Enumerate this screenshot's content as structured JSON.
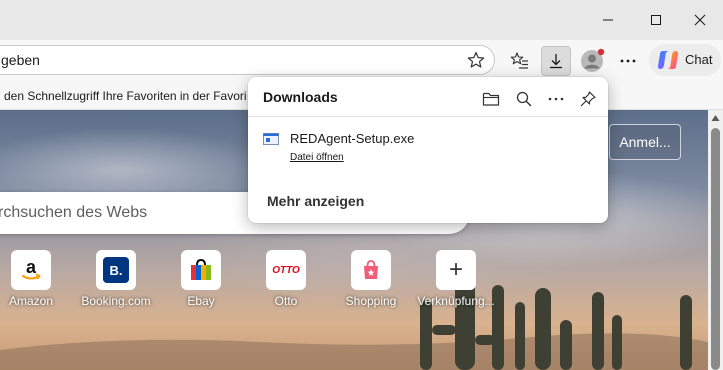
{
  "browser": {
    "address_text": "geben",
    "favorites_text": "den Schnellzugriff Ihre Favoriten in der Favori",
    "chat_label": "Chat"
  },
  "page": {
    "search_placeholder": "rchsuchen des Webs",
    "signin_label": "Anmel..."
  },
  "tiles": [
    {
      "label": "Amazon",
      "icon": "amazon-icon"
    },
    {
      "label": "Booking.com",
      "icon": "booking-icon",
      "glyph": "B."
    },
    {
      "label": "Ebay",
      "icon": "ebay-icon"
    },
    {
      "label": "Otto",
      "icon": "otto-icon",
      "glyph": "OTTO"
    },
    {
      "label": "Shopping",
      "icon": "shopping-bag-icon"
    },
    {
      "label": "Verknüpfung...",
      "icon": "plus-icon",
      "glyph": "+"
    }
  ],
  "downloads": {
    "title": "Downloads",
    "file_name": "REDAgent-Setup.exe",
    "open_file": "Datei öffnen",
    "show_more": "Mehr anzeigen"
  },
  "colors": {
    "booking": "#003580",
    "otto": "#e3051b",
    "shopping": "#f25c7b",
    "profile_dot": "#d13438"
  }
}
